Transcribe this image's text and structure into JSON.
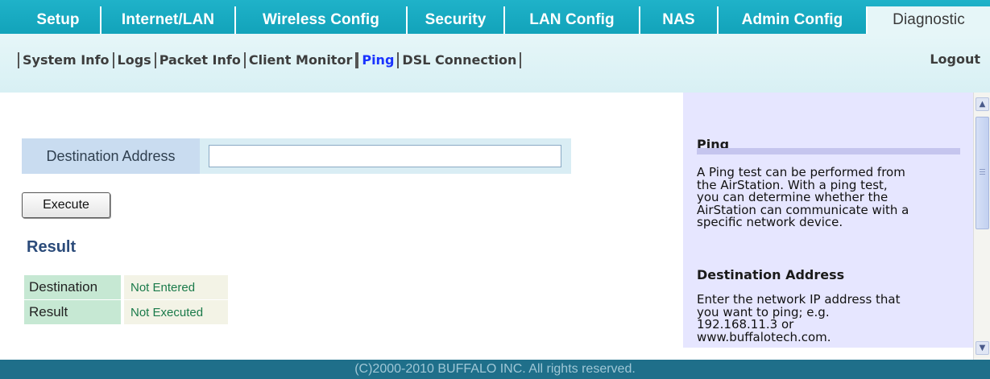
{
  "nav": {
    "tabs": [
      {
        "label": "Setup"
      },
      {
        "label": "Internet/LAN"
      },
      {
        "label": "Wireless Config"
      },
      {
        "label": "Security"
      },
      {
        "label": "LAN Config"
      },
      {
        "label": "NAS"
      },
      {
        "label": "Admin Config"
      },
      {
        "label": "Diagnostic"
      }
    ],
    "active_tab": "Diagnostic"
  },
  "subnav": {
    "items": [
      {
        "label": "System Info"
      },
      {
        "label": "Logs"
      },
      {
        "label": "Packet Info"
      },
      {
        "label": "Client Monitor"
      },
      {
        "label": "Ping"
      },
      {
        "label": "DSL Connection"
      }
    ],
    "active_item": "Ping",
    "logout_label": "Logout"
  },
  "form": {
    "destination_label": "Destination Address",
    "destination_value": "",
    "execute_label": "Execute"
  },
  "result": {
    "title": "Result",
    "rows": [
      {
        "key": "Destination",
        "value": "Not Entered"
      },
      {
        "key": "Result",
        "value": "Not Executed"
      }
    ]
  },
  "help": {
    "title": "Ping",
    "intro_lines": [
      "A Ping test can be performed from",
      "the AirStation. With a ping test,",
      "you can determine whether the",
      "AirStation can communicate with a",
      "specific network device."
    ],
    "dest_heading": "Destination Address",
    "dest_lines": [
      "Enter the network IP address that",
      "you want to ping; e.g.",
      "192.168.11.3 or",
      "www.buffalotech.com."
    ]
  },
  "footer": {
    "copyright": "(C)2000-2010 BUFFALO INC. All rights reserved."
  },
  "colors": {
    "tab_bar": "#1fb2c9",
    "active_subtab": "#1a33ff",
    "footer": "#1f6f8a",
    "help_panel": "#e6e6ff"
  }
}
